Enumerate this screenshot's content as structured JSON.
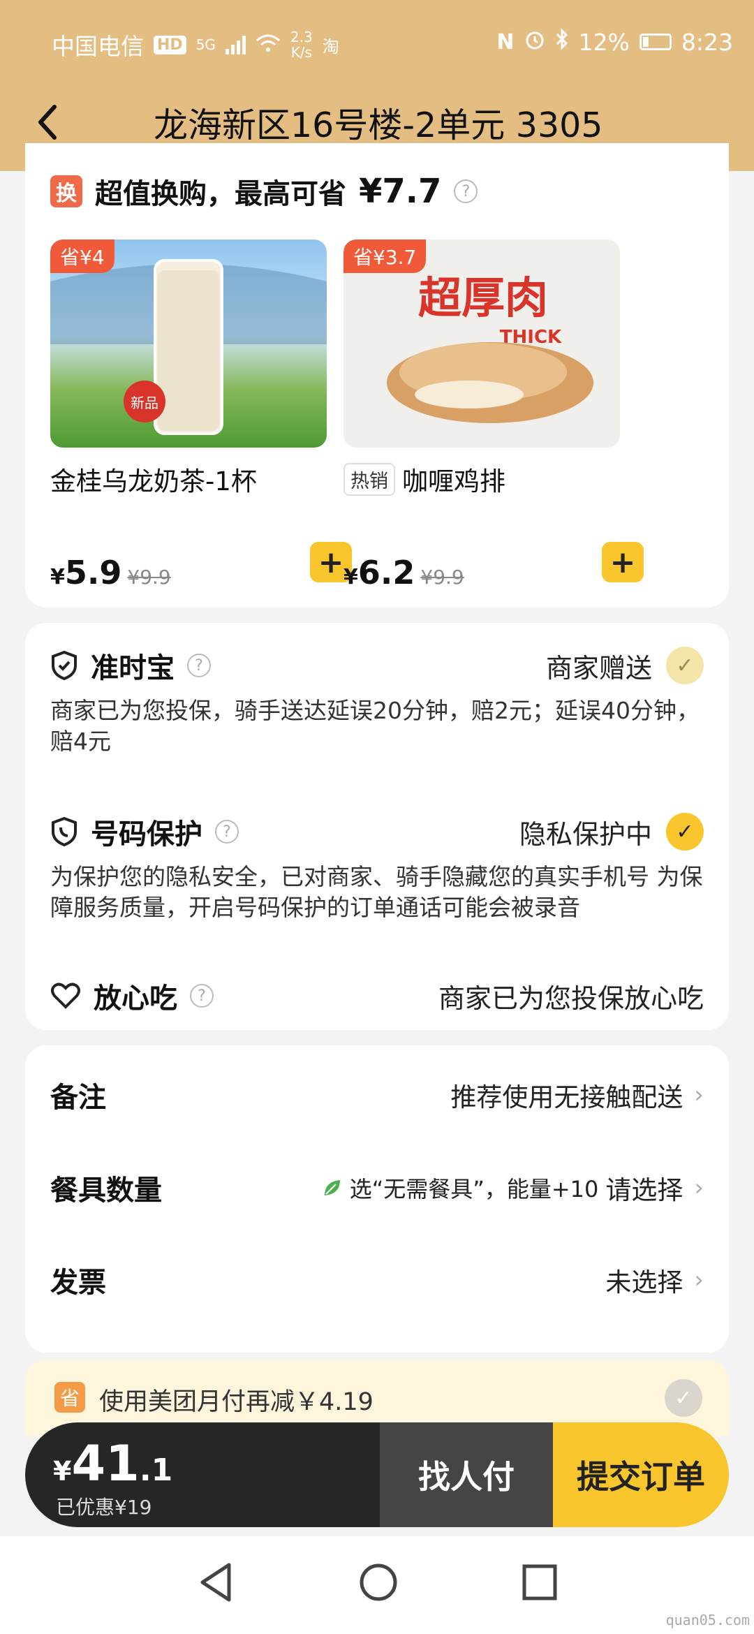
{
  "status_bar": {
    "carrier": "中国电信",
    "hd": "HD",
    "net": "5G",
    "speed_value": "2.3",
    "speed_unit": "K/s",
    "tao": "淘",
    "battery": "12%",
    "time": "8:23"
  },
  "header": {
    "title": "龙海新区16号楼-2单元 3305"
  },
  "exchange": {
    "icon_text": "换",
    "title": "超值换购，最高可省",
    "max_save": "¥7.7",
    "products": [
      {
        "save_tag": "省¥4",
        "name": "金桂乌龙奶茶-1杯",
        "price_symbol": "¥",
        "price": "5.9",
        "old_price": "¥9.9"
      },
      {
        "save_tag": "省¥3.7",
        "hot_tag": "热销",
        "name": "咖喱鸡排",
        "price_symbol": "¥",
        "price": "6.2",
        "old_price": "¥9.9"
      }
    ]
  },
  "services": [
    {
      "title": "准时宝",
      "status": "商家赠送",
      "desc": "商家已为您投保，骑手送达延误20分钟，赔2元；延误40分钟，赔4元"
    },
    {
      "title": "号码保护",
      "status": "隐私保护中",
      "desc": "为保护您的隐私安全，已对商家、骑手隐藏您的真实手机号 为保障服务质量，开启号码保护的订单通话可能会被录音"
    },
    {
      "title": "放心吃",
      "status": "商家已为您投保放心吃"
    }
  ],
  "options": {
    "remark_label": "备注",
    "remark_value": "推荐使用无接触配送",
    "tableware_label": "餐具数量",
    "tableware_hint": "选“无需餐具”，能量+10",
    "tableware_value": "请选择",
    "invoice_label": "发票",
    "invoice_value": "未选择"
  },
  "monthly_pay": {
    "icon_text": "省",
    "text": "使用美团月付再减￥4.19"
  },
  "checkout": {
    "currency": "¥",
    "total_int": "41",
    "total_dec": ".1",
    "discount": "已优惠¥19",
    "find_payer": "找人付",
    "submit": "提交订单"
  },
  "watermark": "quan05.com"
}
